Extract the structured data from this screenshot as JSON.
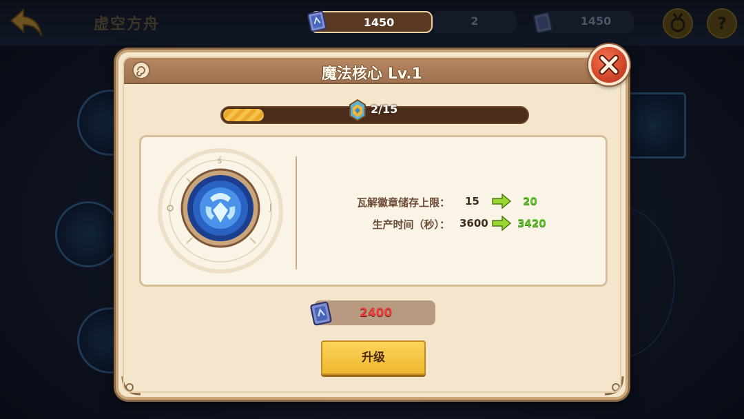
{
  "header": {
    "title": "虚空方舟",
    "resources": {
      "main_value": "1450",
      "secondary_value": "2",
      "tertiary_value": "1450"
    },
    "icons": [
      "back-arrow-icon",
      "medal-icon",
      "help-icon"
    ],
    "help_glyph": "?"
  },
  "dialog": {
    "title": "魔法核心 Lv.1",
    "progress": {
      "text": "2/15",
      "current": 2,
      "max": 15
    },
    "stats": [
      {
        "label": "瓦解徽章储存上限：",
        "old": "15",
        "new": "20"
      },
      {
        "label": "生产时间（秒）：",
        "old": "3600",
        "new": "3420"
      }
    ],
    "cost": {
      "value": "2400"
    },
    "upgrade_label": "升级"
  },
  "colors": {
    "accent_gold": "#f5c34a",
    "close_red": "#d2462a",
    "panel_bg": "#f3e6cd",
    "cost_red": "#e8403a",
    "new_value_green": "#5fbf2a"
  }
}
